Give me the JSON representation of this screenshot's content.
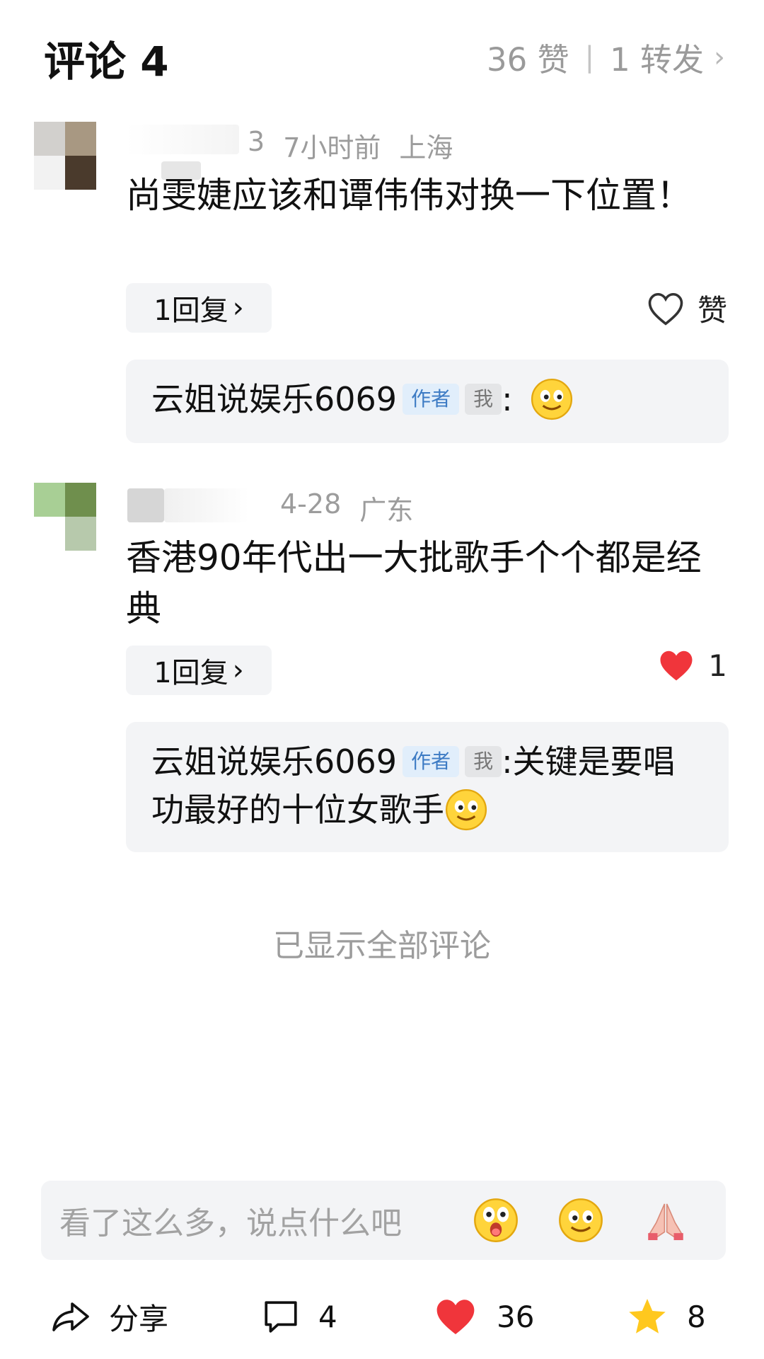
{
  "header": {
    "title": "评论 4",
    "likes": "36 赞",
    "forwards": "1 转发"
  },
  "comments": [
    {
      "meta_tail": "3",
      "time": "7小时前",
      "region": "上海",
      "text": "尚雯婕应该和谭伟伟对换一下位置！",
      "reply_count": "1回复",
      "like_label": "赞",
      "liked": false,
      "reply": {
        "author": "云姐说娱乐6069",
        "author_tag": "作者",
        "me_tag": "我",
        "text": "",
        "emoji": "smile-emoji"
      }
    },
    {
      "time": "4-28",
      "region": "广东",
      "text": "香港90年代出一大批歌手个个都是经典",
      "reply_count": "1回复",
      "like_label": "1",
      "liked": true,
      "reply": {
        "author": "云姐说娱乐6069",
        "author_tag": "作者",
        "me_tag": "我",
        "text": "关键是要唱功最好的十位女歌手",
        "emoji": "smile-emoji"
      }
    }
  ],
  "footer_note": "已显示全部评论",
  "input": {
    "placeholder": "看了这么多，说点什么吧",
    "emojis": [
      "surprised-emoji",
      "smile-emoji",
      "pray-emoji"
    ]
  },
  "bottom_bar": {
    "share": "分享",
    "comments": "4",
    "likes": "36",
    "favorites": "8"
  },
  "colors": {
    "like_red": "#f0353b",
    "star_yellow": "#ffc81e",
    "author_blue": "#3d7bc4",
    "card_bg": "#f3f4f6"
  }
}
